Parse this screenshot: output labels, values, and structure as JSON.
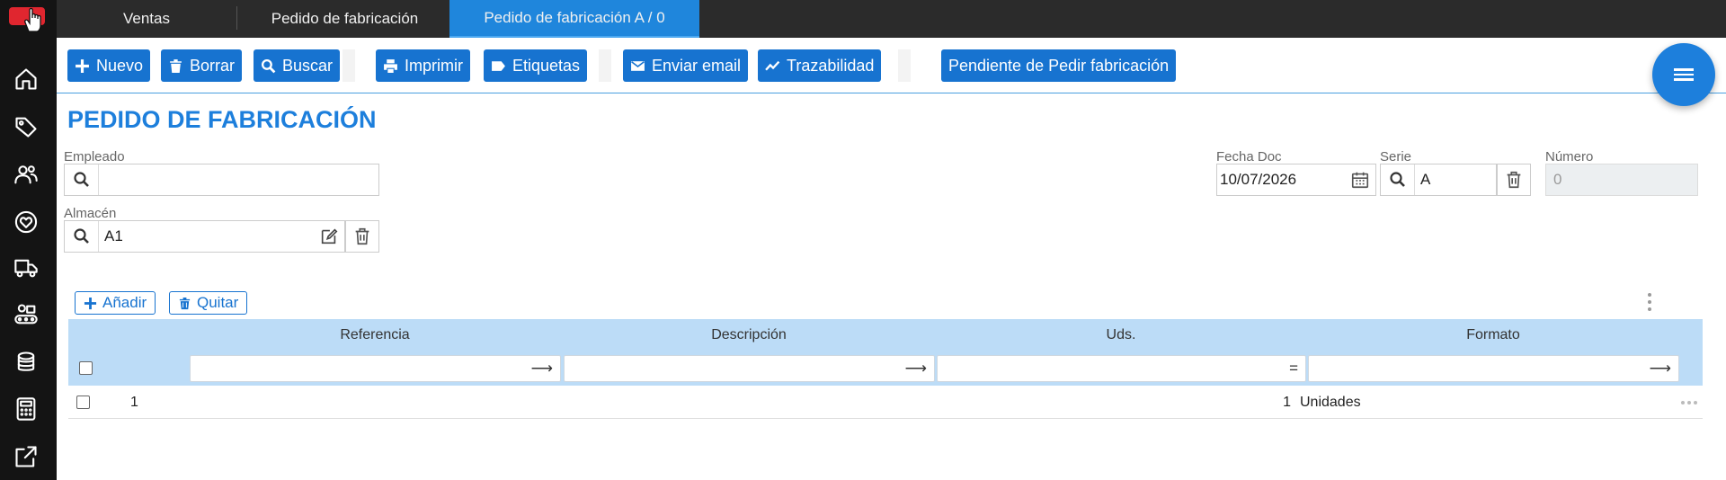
{
  "colors": {
    "sidebar": "#141414",
    "topbar": "#2b2b2b",
    "accent": "#1773d0",
    "active_tab": "#1f86dc",
    "title": "#1d7fdc",
    "grid_header": "#bcdcf7"
  },
  "sidebar": {
    "icons": [
      "home-icon",
      "tag-icon",
      "users-icon",
      "heart-circle-icon",
      "truck-icon",
      "conveyor-icon",
      "coins-icon",
      "calculator-icon",
      "external-link-icon"
    ]
  },
  "tabs": [
    {
      "label": "Ventas"
    },
    {
      "label": "Pedido de fabricación"
    },
    {
      "label": "Pedido de fabricación A / 0",
      "active": true
    }
  ],
  "toolbar": {
    "nuevo": "Nuevo",
    "borrar": "Borrar",
    "buscar": "Buscar",
    "imprimir": "Imprimir",
    "etiquetas": "Etiquetas",
    "enviar_email": "Enviar email",
    "trazabilidad": "Trazabilidad",
    "pendiente": "Pendiente de Pedir fabricación"
  },
  "page": {
    "title": "PEDIDO DE FABRICACIÓN"
  },
  "form": {
    "empleado": {
      "label": "Empleado",
      "value": ""
    },
    "almacen": {
      "label": "Almacén",
      "value": "A1"
    },
    "fecha_doc": {
      "label": "Fecha Doc",
      "value": "10/07/2026"
    },
    "serie": {
      "label": "Serie",
      "value": "A"
    },
    "numero": {
      "label": "Número",
      "value": "0"
    }
  },
  "grid": {
    "add_label": "Añadir",
    "remove_label": "Quitar",
    "columns": [
      "Referencia",
      "Descripción",
      "Uds.",
      "Formato"
    ],
    "filter_ops": [
      "⟶",
      "⟶",
      "=",
      "⟶"
    ],
    "rows": [
      {
        "num": "1",
        "referencia": "",
        "descripcion": "",
        "uds": "1",
        "formato": "Unidades"
      }
    ]
  }
}
